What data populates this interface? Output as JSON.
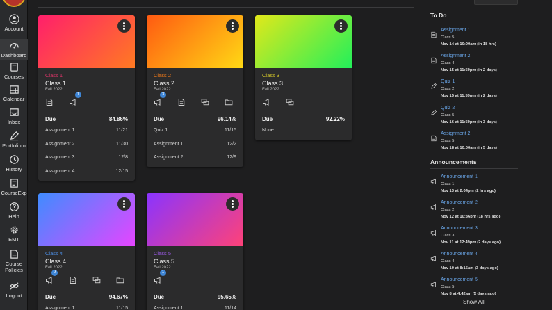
{
  "nav": [
    {
      "label": "Account",
      "icon": "account-icon"
    },
    {
      "label": "Dashboard",
      "icon": "dashboard-icon"
    },
    {
      "label": "Courses",
      "icon": "courses-icon"
    },
    {
      "label": "Calendar",
      "icon": "calendar-icon"
    },
    {
      "label": "Inbox",
      "icon": "inbox-icon"
    },
    {
      "label": "Portfolium",
      "icon": "portfolium-icon"
    },
    {
      "label": "History",
      "icon": "history-icon"
    },
    {
      "label": "CourseExp",
      "icon": "courseexp-icon"
    },
    {
      "label": "Help",
      "icon": "help-icon"
    },
    {
      "label": "EMT",
      "icon": "gear-icon"
    },
    {
      "label": "Course Policies",
      "icon": "policies-icon"
    },
    {
      "label": "Logout",
      "icon": "logout-icon"
    }
  ],
  "cards": [
    {
      "code": "Class 1",
      "name": "Class 1",
      "term": "Fall 2022",
      "gradient": [
        "#ff1f6b",
        "#ff7a22"
      ],
      "code_color": "#e0356a",
      "icons": [
        "assignments-icon",
        "announcements-icon"
      ],
      "badges": [
        {
          "text": "1"
        }
      ],
      "due_label": "Due",
      "grade": "84.86%",
      "rows": [
        {
          "name": "Assignment 1",
          "date": "11/21"
        },
        {
          "name": "Assignment 2",
          "date": "11/30"
        },
        {
          "name": "Assignment 3",
          "date": "12/8"
        },
        {
          "name": "Assignment 4",
          "date": "12/15"
        }
      ]
    },
    {
      "code": "Class 2",
      "name": "Class 2",
      "term": "Fall 2022",
      "gradient": [
        "#ff5a12",
        "#ffd914"
      ],
      "code_color": "#f07a1a",
      "icons": [
        "announcements-icon",
        "assignments-icon",
        "discussions-icon",
        "files-icon"
      ],
      "badges": [
        {
          "text": "3"
        }
      ],
      "due_label": "Due",
      "grade": "96.14%",
      "rows": [
        {
          "name": "Quiz 1",
          "date": "11/15"
        },
        {
          "name": "Assignment 1",
          "date": "12/2"
        },
        {
          "name": "Assignment 2",
          "date": "12/9"
        }
      ]
    },
    {
      "code": "Class 3",
      "name": "Class 3",
      "term": "Fall 2022",
      "gradient": [
        "#e1e81a",
        "#22f05a"
      ],
      "code_color": "#d4c72a",
      "icons": [
        "announcements-icon",
        "discussions-icon"
      ],
      "badges": [],
      "due_label": "Due",
      "grade": "92.22%",
      "rows": [
        {
          "name": "None",
          "date": ""
        }
      ]
    },
    {
      "code": "Class 4",
      "name": "Class 4",
      "term": "Fall 2022",
      "gradient": [
        "#3f8cff",
        "#e545ff"
      ],
      "code_color": "#4d8fe6",
      "icons": [
        "announcements-icon",
        "assignments-icon",
        "discussions-icon",
        "files-icon"
      ],
      "badges": [
        {
          "text": "9"
        }
      ],
      "due_label": "Due",
      "grade": "94.67%",
      "rows": [
        {
          "name": "Assignment 1",
          "date": "11/15"
        }
      ]
    },
    {
      "code": "Class 5",
      "name": "Class 5",
      "term": "Fall 2022",
      "gradient": [
        "#8a34ff",
        "#ff4278"
      ],
      "code_color": "#9b59e6",
      "icons": [
        "announcements-icon"
      ],
      "badges": [
        {
          "text": "1"
        }
      ],
      "due_label": "Due",
      "grade": "95.65%",
      "rows": [
        {
          "name": "Assignment 1",
          "date": "11/14"
        }
      ]
    }
  ],
  "todo": {
    "heading": "To Do",
    "items": [
      {
        "title": "Assignment 1",
        "course": "Class 5",
        "date": "Nov 14 at 10:00am (in 18 hrs)",
        "icon": "assignments-icon"
      },
      {
        "title": "Assignment 2",
        "course": "Class 4",
        "date": "Nov 15 at 11:59pm (in 2 days)",
        "icon": "assignments-icon"
      },
      {
        "title": "Quiz 1",
        "course": "Class 2",
        "date": "Nov 15 at 11:59pm (in 2 days)",
        "icon": "quiz-icon"
      },
      {
        "title": "Quiz 2",
        "course": "Class 5",
        "date": "Nov 16 at 11:59pm (in 3 days)",
        "icon": "quiz-icon"
      },
      {
        "title": "Assignment 2",
        "course": "Class 5",
        "date": "Nov 18 at 10:00am (in 5 days)",
        "icon": "assignments-icon"
      }
    ]
  },
  "announcements": {
    "heading": "Announcements",
    "items": [
      {
        "title": "Announcement 1",
        "course": "Class 1",
        "date": "Nov 13 at 2:04pm (2 hrs ago)"
      },
      {
        "title": "Announcement 2",
        "course": "Class 2",
        "date": "Nov 12 at 10:36pm (18 hrs ago)"
      },
      {
        "title": "Announcement 3",
        "course": "Class 3",
        "date": "Nov 11 at 12:49pm (2 days ago)"
      },
      {
        "title": "Announcement 4",
        "course": "Class 4",
        "date": "Nov 10 at 8:15am (3 days ago)"
      },
      {
        "title": "Announcement 5",
        "course": "Class 5",
        "date": "Nov 8 at 4:42am (5 days ago)"
      }
    ],
    "show_all": "Show All"
  }
}
